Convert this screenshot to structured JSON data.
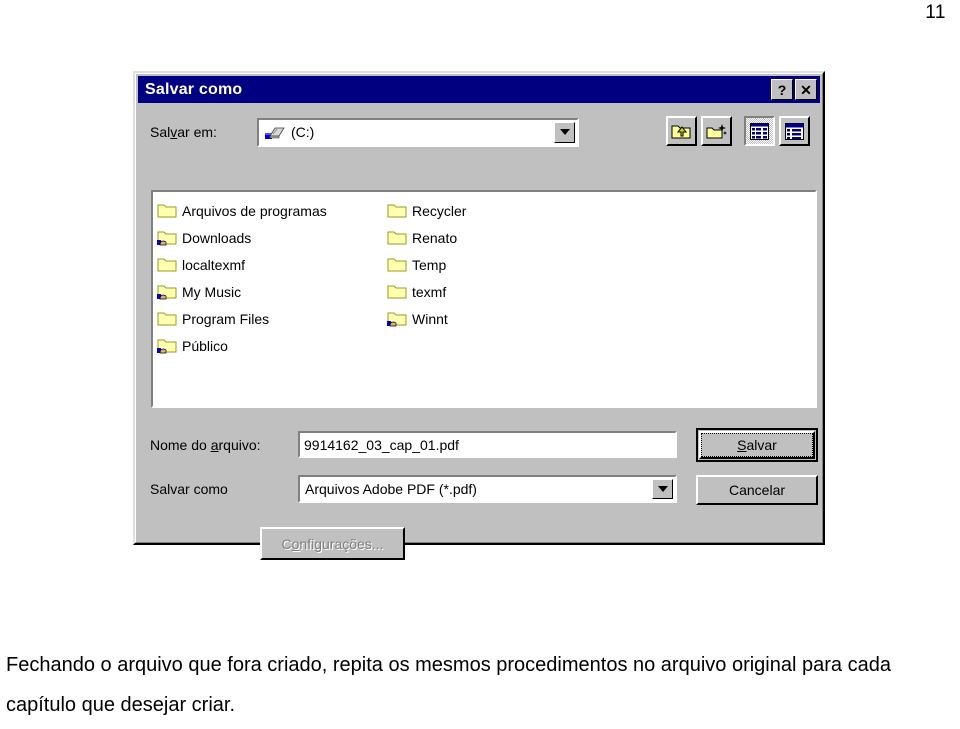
{
  "page": {
    "number": "11",
    "body_text": "Fechando o arquivo que fora criado, repita os mesmos procedimentos no arquivo original para cada capítulo que desejar criar."
  },
  "dialog": {
    "title": "Salvar como",
    "titlebar_buttons": {
      "help": "?",
      "close": "✕"
    },
    "lookin": {
      "label_before": "Sal",
      "label_accel": "v",
      "label_after": "ar em:",
      "value": "(C:)",
      "icon": "hard-drive-icon"
    },
    "toolbar": [
      {
        "name": "up-one-level-button",
        "icon": "folder-up-arrow-icon",
        "pressed": false
      },
      {
        "name": "new-folder-button",
        "icon": "folder-sparkle-icon",
        "pressed": false
      },
      {
        "name": "list-view-button",
        "icon": "list-view-icon",
        "pressed": true
      },
      {
        "name": "details-view-button",
        "icon": "details-view-icon",
        "pressed": false
      }
    ],
    "file_list": {
      "column1": [
        {
          "label": "Arquivos de programas",
          "shared": false
        },
        {
          "label": "Downloads",
          "shared": true
        },
        {
          "label": "localtexmf",
          "shared": false
        },
        {
          "label": "My Music",
          "shared": true
        },
        {
          "label": "Program Files",
          "shared": false
        },
        {
          "label": "Público",
          "shared": true
        }
      ],
      "column2": [
        {
          "label": "Recycler",
          "shared": false
        },
        {
          "label": "Renato",
          "shared": false
        },
        {
          "label": "Temp",
          "shared": false
        },
        {
          "label": "texmf",
          "shared": false
        },
        {
          "label": "Winnt",
          "shared": true
        }
      ]
    },
    "filename": {
      "label_before": "Nome do ",
      "label_accel": "a",
      "label_after": "rquivo:",
      "value": "9914162_03_cap_01.pdf"
    },
    "filetype": {
      "label": "Salvar como",
      "value": "Arquivos Adobe PDF (*.pdf)"
    },
    "buttons": {
      "save_accel": "S",
      "save_rest": "alvar",
      "cancel": "Cancelar",
      "settings_before": "C",
      "settings_accel": "o",
      "settings_after": "nfigurações..."
    }
  },
  "colors": {
    "titlebar": "#000080",
    "dialog_face": "#c0c0c0",
    "field_bg": "#ffffff",
    "folder_yellow": "#ffffb0",
    "disabled_text": "#808080"
  }
}
